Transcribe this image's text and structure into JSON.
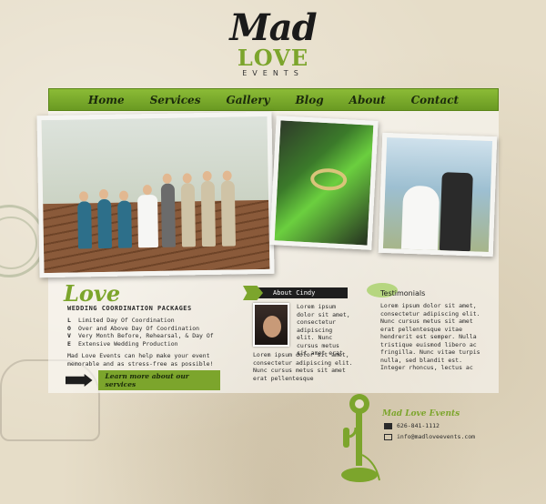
{
  "brand": {
    "mad": "Mad",
    "love": "LOVE",
    "events": "EVENTS"
  },
  "nav": {
    "items": [
      "Home",
      "Services",
      "Gallery",
      "Blog",
      "About",
      "Contact"
    ]
  },
  "love": {
    "title": "Love",
    "subtitle": "WEDDING COORDINATION PACKAGES",
    "list": [
      {
        "letter": "L",
        "text": "Limited Day Of Coordination"
      },
      {
        "letter": "O",
        "text": "Over and Above Day Of Coordination"
      },
      {
        "letter": "V",
        "text": "Very Month Before, Rehearsal, & Day Of"
      },
      {
        "letter": "E",
        "text": "Extensive Wedding Production"
      }
    ],
    "description": "Mad Love Events can help make your event memorable and as stress-free as possible!",
    "learn_more": "Learn more about our services"
  },
  "about": {
    "title": "About Cindy",
    "text1": "Lorem ipsum dolor sit amet, consectetur adipiscing elit. Nunc cursus metus sit amet erat",
    "text2": "Lorem ipsum dolor sit amet, consectetur adipiscing elit. Nunc cursus metus sit amet erat pellentesque"
  },
  "testimonials": {
    "title": "Testimonials",
    "text": "Lorem ipsum dolor sit amet, consectetur adipiscing elit. Nunc cursus metus sit amet erat pellentesque vitae hendrerit est semper. Nulla tristique euismod libero ac fringilla. Nunc vitae turpis nulla, sed blandit est. Integer rhoncus, lectus ac"
  },
  "contact": {
    "title": "Mad Love Events",
    "phone": "626-841-1112",
    "email": "info@madloveevents.com",
    "phone_icon": "phone-icon",
    "email_icon": "email-icon"
  },
  "colors": {
    "accent": "#7ca52c",
    "nav": "#8bbb36",
    "dark": "#1e1e1e"
  }
}
